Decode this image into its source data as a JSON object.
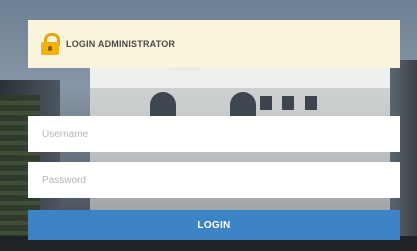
{
  "header": {
    "title": "LOGIN ADMINISTRATOR",
    "icon": "lock-icon"
  },
  "form": {
    "username_placeholder": "Username",
    "username_value": "",
    "password_placeholder": "Password",
    "password_value": "",
    "submit_label": "LOGIN"
  },
  "colors": {
    "header_bg": "#fbf4dc",
    "button_bg": "#3d84c6",
    "lock_icon": "#f2b10f"
  }
}
